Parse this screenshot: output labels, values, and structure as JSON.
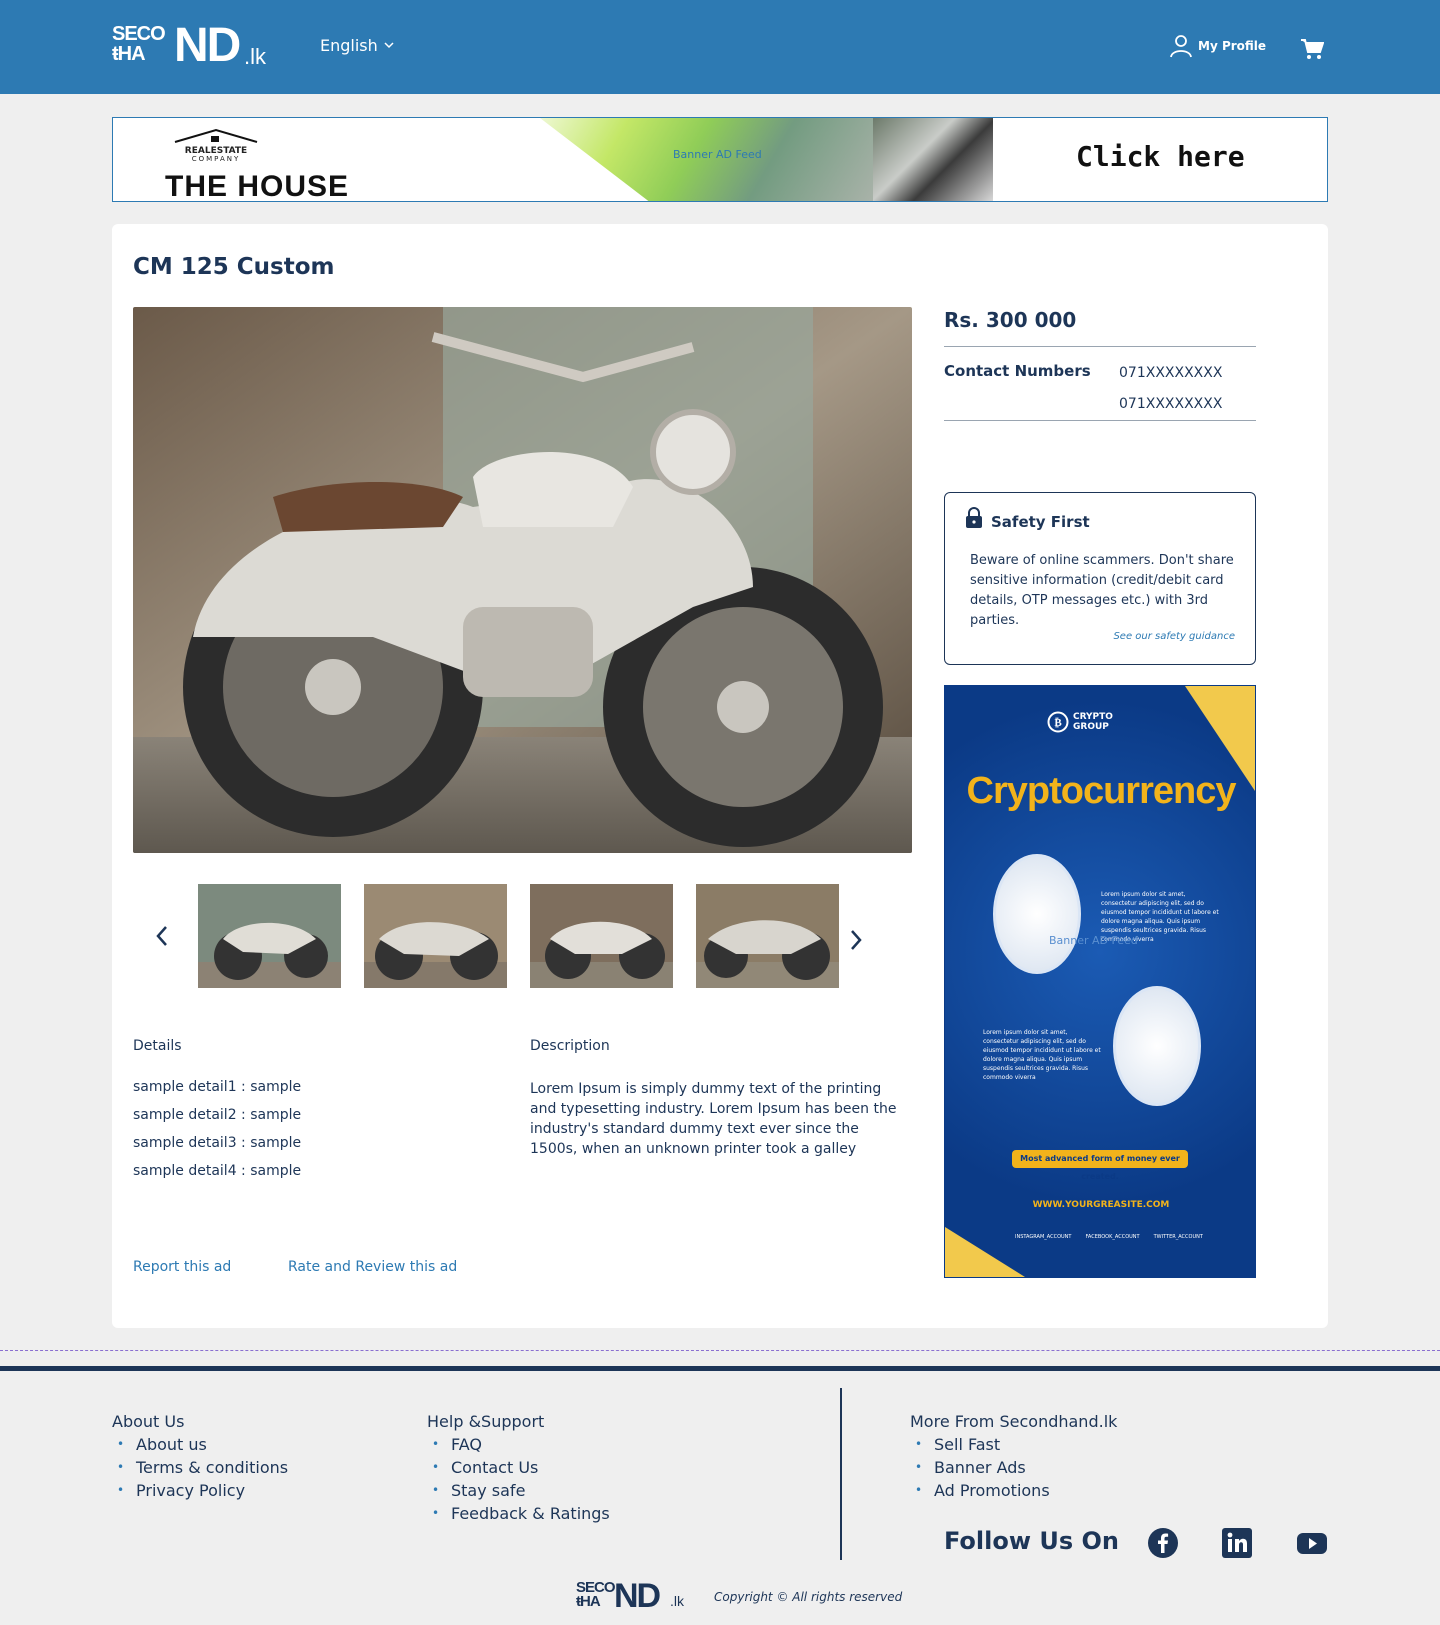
{
  "header": {
    "logo_top": "SECO",
    "logo_bottom": "HA",
    "logo_big": "ND",
    "logo_suffix": ".lk",
    "language": "English",
    "profile_label": "My Profile",
    "bg_color": "#2d7ab3"
  },
  "top_banner": {
    "company_line1": "REALESTATE",
    "company_line2": "COMPANY",
    "headline": "THE HOUSE",
    "overlay_text": "Banner AD Feed",
    "cta": "Click here"
  },
  "listing": {
    "title": "CM 125 Custom",
    "price": "Rs. 300 000",
    "contact_label": "Contact Numbers",
    "phones": [
      "071XXXXXXXX",
      "071XXXXXXXX"
    ],
    "details_heading": "Details",
    "details": [
      "sample detail1 : sample",
      "sample detail2 : sample",
      "sample detail3 : sample",
      "sample detail4 : sample"
    ],
    "description_heading": "Description",
    "description": "Lorem Ipsum is simply dummy text of the printing and typesetting industry. Lorem Ipsum has been the industry's standard dummy text ever since the 1500s, when an unknown printer took a galley",
    "report_link": "Report this ad",
    "rate_link": "Rate and Review this ad"
  },
  "safety": {
    "heading": "Safety First",
    "body": "Beware of online scammers. Don't share sensitive information (credit/debit card details, OTP messages etc.) with 3rd parties.",
    "link": "See our safety guidance"
  },
  "side_ad": {
    "brand": "CRYPTO GROUP",
    "brand_line1": "CRYPTO",
    "brand_line2": "GROUP",
    "title": "Cryptocurrency",
    "overlay_text": "Banner AD Feed",
    "lorem": "Lorem ipsum dolor sit amet, consectetur adipiscing elit, sed do eiusmod tempor incididunt ut labore et dolore magna aliqua. Quis ipsum suspendis seultrices gravida. Risus commodo viverra",
    "tagline": "Most advanced form of money ever created.",
    "url": "WWW.YOURGREASITE.COM",
    "social": [
      "INSTAGRAM_ACCOUNT",
      "FACEBOOK_ACCOUNT",
      "TWITTER_ACCOUNT"
    ],
    "accent": "#f2b31b"
  },
  "footer": {
    "col1_heading": "About Us",
    "col1_items": [
      "About us",
      "Terms & conditions",
      "Privacy Policy"
    ],
    "col2_heading": "Help &Support",
    "col2_items": [
      "FAQ",
      "Contact Us",
      "Stay safe",
      "Feedback & Ratings"
    ],
    "col3_heading": "More From Secondhand.lk",
    "col3_items": [
      "Sell Fast",
      "Banner Ads",
      "Ad Promotions"
    ],
    "follow": "Follow Us On",
    "copyright": "Copyright © All rights reserved",
    "logo_top": "SECO",
    "logo_bottom": "HA",
    "logo_big": "ND",
    "logo_suffix": ".lk"
  }
}
